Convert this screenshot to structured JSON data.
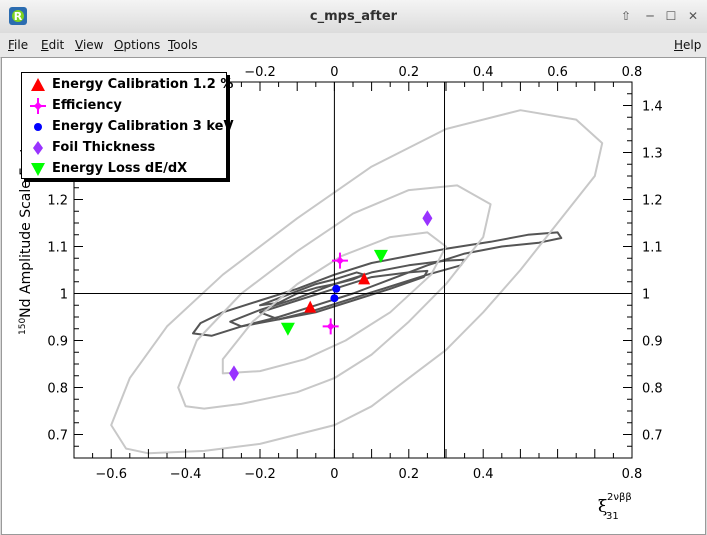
{
  "window": {
    "title": "c_mps_after"
  },
  "menu": {
    "file": "File",
    "edit": "Edit",
    "view": "View",
    "options": "Options",
    "tools": "Tools",
    "help": "Help"
  },
  "window_buttons": {
    "up": "⇧",
    "min": "─",
    "max": "☐",
    "close": "✕"
  },
  "chart_data": {
    "type": "scatter",
    "title": "",
    "ylabel_pre": "150",
    "ylabel_main": "Nd Amplitude Scale Factor",
    "xlabel_main": "ξ",
    "xlabel_sup": "2νββ",
    "xlabel_sub": "31",
    "xlim": [
      -0.7,
      0.8
    ],
    "ylim": [
      0.65,
      1.45
    ],
    "xticks": [
      -0.6,
      -0.4,
      -0.2,
      0,
      0.2,
      0.4,
      0.8
    ],
    "xticks_top": [
      -0.2,
      0,
      0.2,
      0.4,
      0.6,
      0.8
    ],
    "yticks": [
      0.7,
      0.8,
      0.9,
      1,
      1.1,
      1.2,
      1.3,
      1.4
    ],
    "reference_lines": {
      "x": [
        0,
        0.296
      ],
      "y": [
        1.0
      ]
    },
    "legend_position": "top-left",
    "series": [
      {
        "name": "Energy Calibration 1.2 %",
        "marker": "triangle-up",
        "color": "#ff0000",
        "points": [
          [
            -0.065,
            0.97
          ],
          [
            0.08,
            1.03
          ]
        ]
      },
      {
        "name": "Efficiency",
        "marker": "star",
        "color": "#ff00ff",
        "points": [
          [
            0.015,
            1.07
          ],
          [
            -0.01,
            0.93
          ]
        ]
      },
      {
        "name": "Energy Calibration 3 keV",
        "marker": "circle",
        "color": "#0000ff",
        "points": [
          [
            0.005,
            1.01
          ],
          [
            0.0,
            0.99
          ]
        ]
      },
      {
        "name": "Foil Thickness",
        "marker": "diamond",
        "color": "#9933ff",
        "points": [
          [
            0.25,
            1.16
          ],
          [
            -0.27,
            0.83
          ]
        ]
      },
      {
        "name": "Energy Loss dE/dX",
        "marker": "triangle-down",
        "color": "#00ff00",
        "points": [
          [
            0.125,
            1.08
          ],
          [
            -0.125,
            0.925
          ]
        ]
      }
    ],
    "contours": [
      {
        "color": "#555555",
        "points": [
          [
            -0.38,
            0.915
          ],
          [
            -0.36,
            0.937
          ],
          [
            -0.3,
            0.96
          ],
          [
            -0.2,
            0.985
          ],
          [
            -0.1,
            1.01
          ],
          [
            0.0,
            1.04
          ],
          [
            0.1,
            1.065
          ],
          [
            0.2,
            1.08
          ],
          [
            0.3,
            1.095
          ],
          [
            0.42,
            1.11
          ],
          [
            0.52,
            1.125
          ],
          [
            0.6,
            1.13
          ],
          [
            0.61,
            1.118
          ],
          [
            0.55,
            1.108
          ],
          [
            0.45,
            1.1
          ],
          [
            0.35,
            1.085
          ],
          [
            0.25,
            1.06
          ],
          [
            0.15,
            1.03
          ],
          [
            0.05,
            1.0
          ],
          [
            -0.05,
            0.975
          ],
          [
            -0.15,
            0.95
          ],
          [
            -0.25,
            0.93
          ],
          [
            -0.33,
            0.91
          ],
          [
            -0.38,
            0.915
          ]
        ]
      },
      {
        "color": "#555555",
        "points": [
          [
            -0.28,
            0.94
          ],
          [
            -0.2,
            0.965
          ],
          [
            -0.1,
            0.99
          ],
          [
            0.0,
            1.02
          ],
          [
            0.1,
            1.045
          ],
          [
            0.2,
            1.06
          ],
          [
            0.3,
            1.07
          ],
          [
            0.35,
            1.072
          ],
          [
            0.34,
            1.06
          ],
          [
            0.25,
            1.04
          ],
          [
            0.15,
            1.015
          ],
          [
            0.05,
            0.99
          ],
          [
            -0.05,
            0.965
          ],
          [
            -0.15,
            0.945
          ],
          [
            -0.25,
            0.93
          ],
          [
            -0.28,
            0.94
          ]
        ]
      },
      {
        "color": "#555555",
        "points": [
          [
            -0.2,
            0.96
          ],
          [
            -0.1,
            0.985
          ],
          [
            0.0,
            1.01
          ],
          [
            0.1,
            1.035
          ],
          [
            0.2,
            1.045
          ],
          [
            0.25,
            1.048
          ],
          [
            0.24,
            1.035
          ],
          [
            0.15,
            1.01
          ],
          [
            0.05,
            0.985
          ],
          [
            -0.05,
            0.96
          ],
          [
            -0.15,
            0.945
          ],
          [
            -0.2,
            0.96
          ]
        ]
      },
      {
        "color": "#555555",
        "points": [
          [
            -0.2,
            0.975
          ],
          [
            -0.15,
            0.98
          ],
          [
            -0.1,
            1.0
          ],
          [
            -0.05,
            1.012
          ],
          [
            0.0,
            1.02
          ],
          [
            0.05,
            1.03
          ],
          [
            0.08,
            1.04
          ],
          [
            0.06,
            1.045
          ],
          [
            0.0,
            1.03
          ],
          [
            -0.05,
            1.02
          ],
          [
            -0.1,
            1.005
          ],
          [
            -0.15,
            0.99
          ],
          [
            -0.2,
            0.975
          ]
        ]
      },
      {
        "color": "#c8c8c8",
        "points": [
          [
            -0.56,
            0.67
          ],
          [
            -0.6,
            0.72
          ],
          [
            -0.55,
            0.82
          ],
          [
            -0.45,
            0.93
          ],
          [
            -0.3,
            1.04
          ],
          [
            -0.1,
            1.16
          ],
          [
            0.1,
            1.27
          ],
          [
            0.3,
            1.35
          ],
          [
            0.5,
            1.39
          ],
          [
            0.65,
            1.37
          ],
          [
            0.72,
            1.32
          ],
          [
            0.7,
            1.25
          ],
          [
            0.6,
            1.15
          ],
          [
            0.5,
            1.05
          ],
          [
            0.4,
            0.96
          ],
          [
            0.3,
            0.88
          ],
          [
            0.2,
            0.82
          ],
          [
            0.1,
            0.76
          ],
          [
            0.0,
            0.72
          ],
          [
            -0.1,
            0.7
          ],
          [
            -0.2,
            0.68
          ],
          [
            -0.35,
            0.665
          ],
          [
            -0.5,
            0.66
          ],
          [
            -0.56,
            0.67
          ]
        ]
      },
      {
        "color": "#c8c8c8",
        "points": [
          [
            -0.4,
            0.76
          ],
          [
            -0.42,
            0.8
          ],
          [
            -0.37,
            0.9
          ],
          [
            -0.25,
            1.0
          ],
          [
            -0.1,
            1.09
          ],
          [
            0.05,
            1.17
          ],
          [
            0.2,
            1.22
          ],
          [
            0.33,
            1.23
          ],
          [
            0.42,
            1.19
          ],
          [
            0.4,
            1.12
          ],
          [
            0.3,
            1.02
          ],
          [
            0.2,
            0.94
          ],
          [
            0.1,
            0.87
          ],
          [
            0.0,
            0.82
          ],
          [
            -0.1,
            0.79
          ],
          [
            -0.25,
            0.765
          ],
          [
            -0.35,
            0.755
          ],
          [
            -0.4,
            0.76
          ]
        ]
      },
      {
        "color": "#c8c8c8",
        "points": [
          [
            -0.3,
            0.83
          ],
          [
            -0.3,
            0.86
          ],
          [
            -0.22,
            0.94
          ],
          [
            -0.1,
            1.02
          ],
          [
            0.02,
            1.08
          ],
          [
            0.15,
            1.12
          ],
          [
            0.25,
            1.13
          ],
          [
            0.3,
            1.1
          ],
          [
            0.26,
            1.04
          ],
          [
            0.15,
            0.96
          ],
          [
            0.03,
            0.9
          ],
          [
            -0.08,
            0.86
          ],
          [
            -0.2,
            0.835
          ],
          [
            -0.3,
            0.83
          ]
        ]
      }
    ]
  }
}
